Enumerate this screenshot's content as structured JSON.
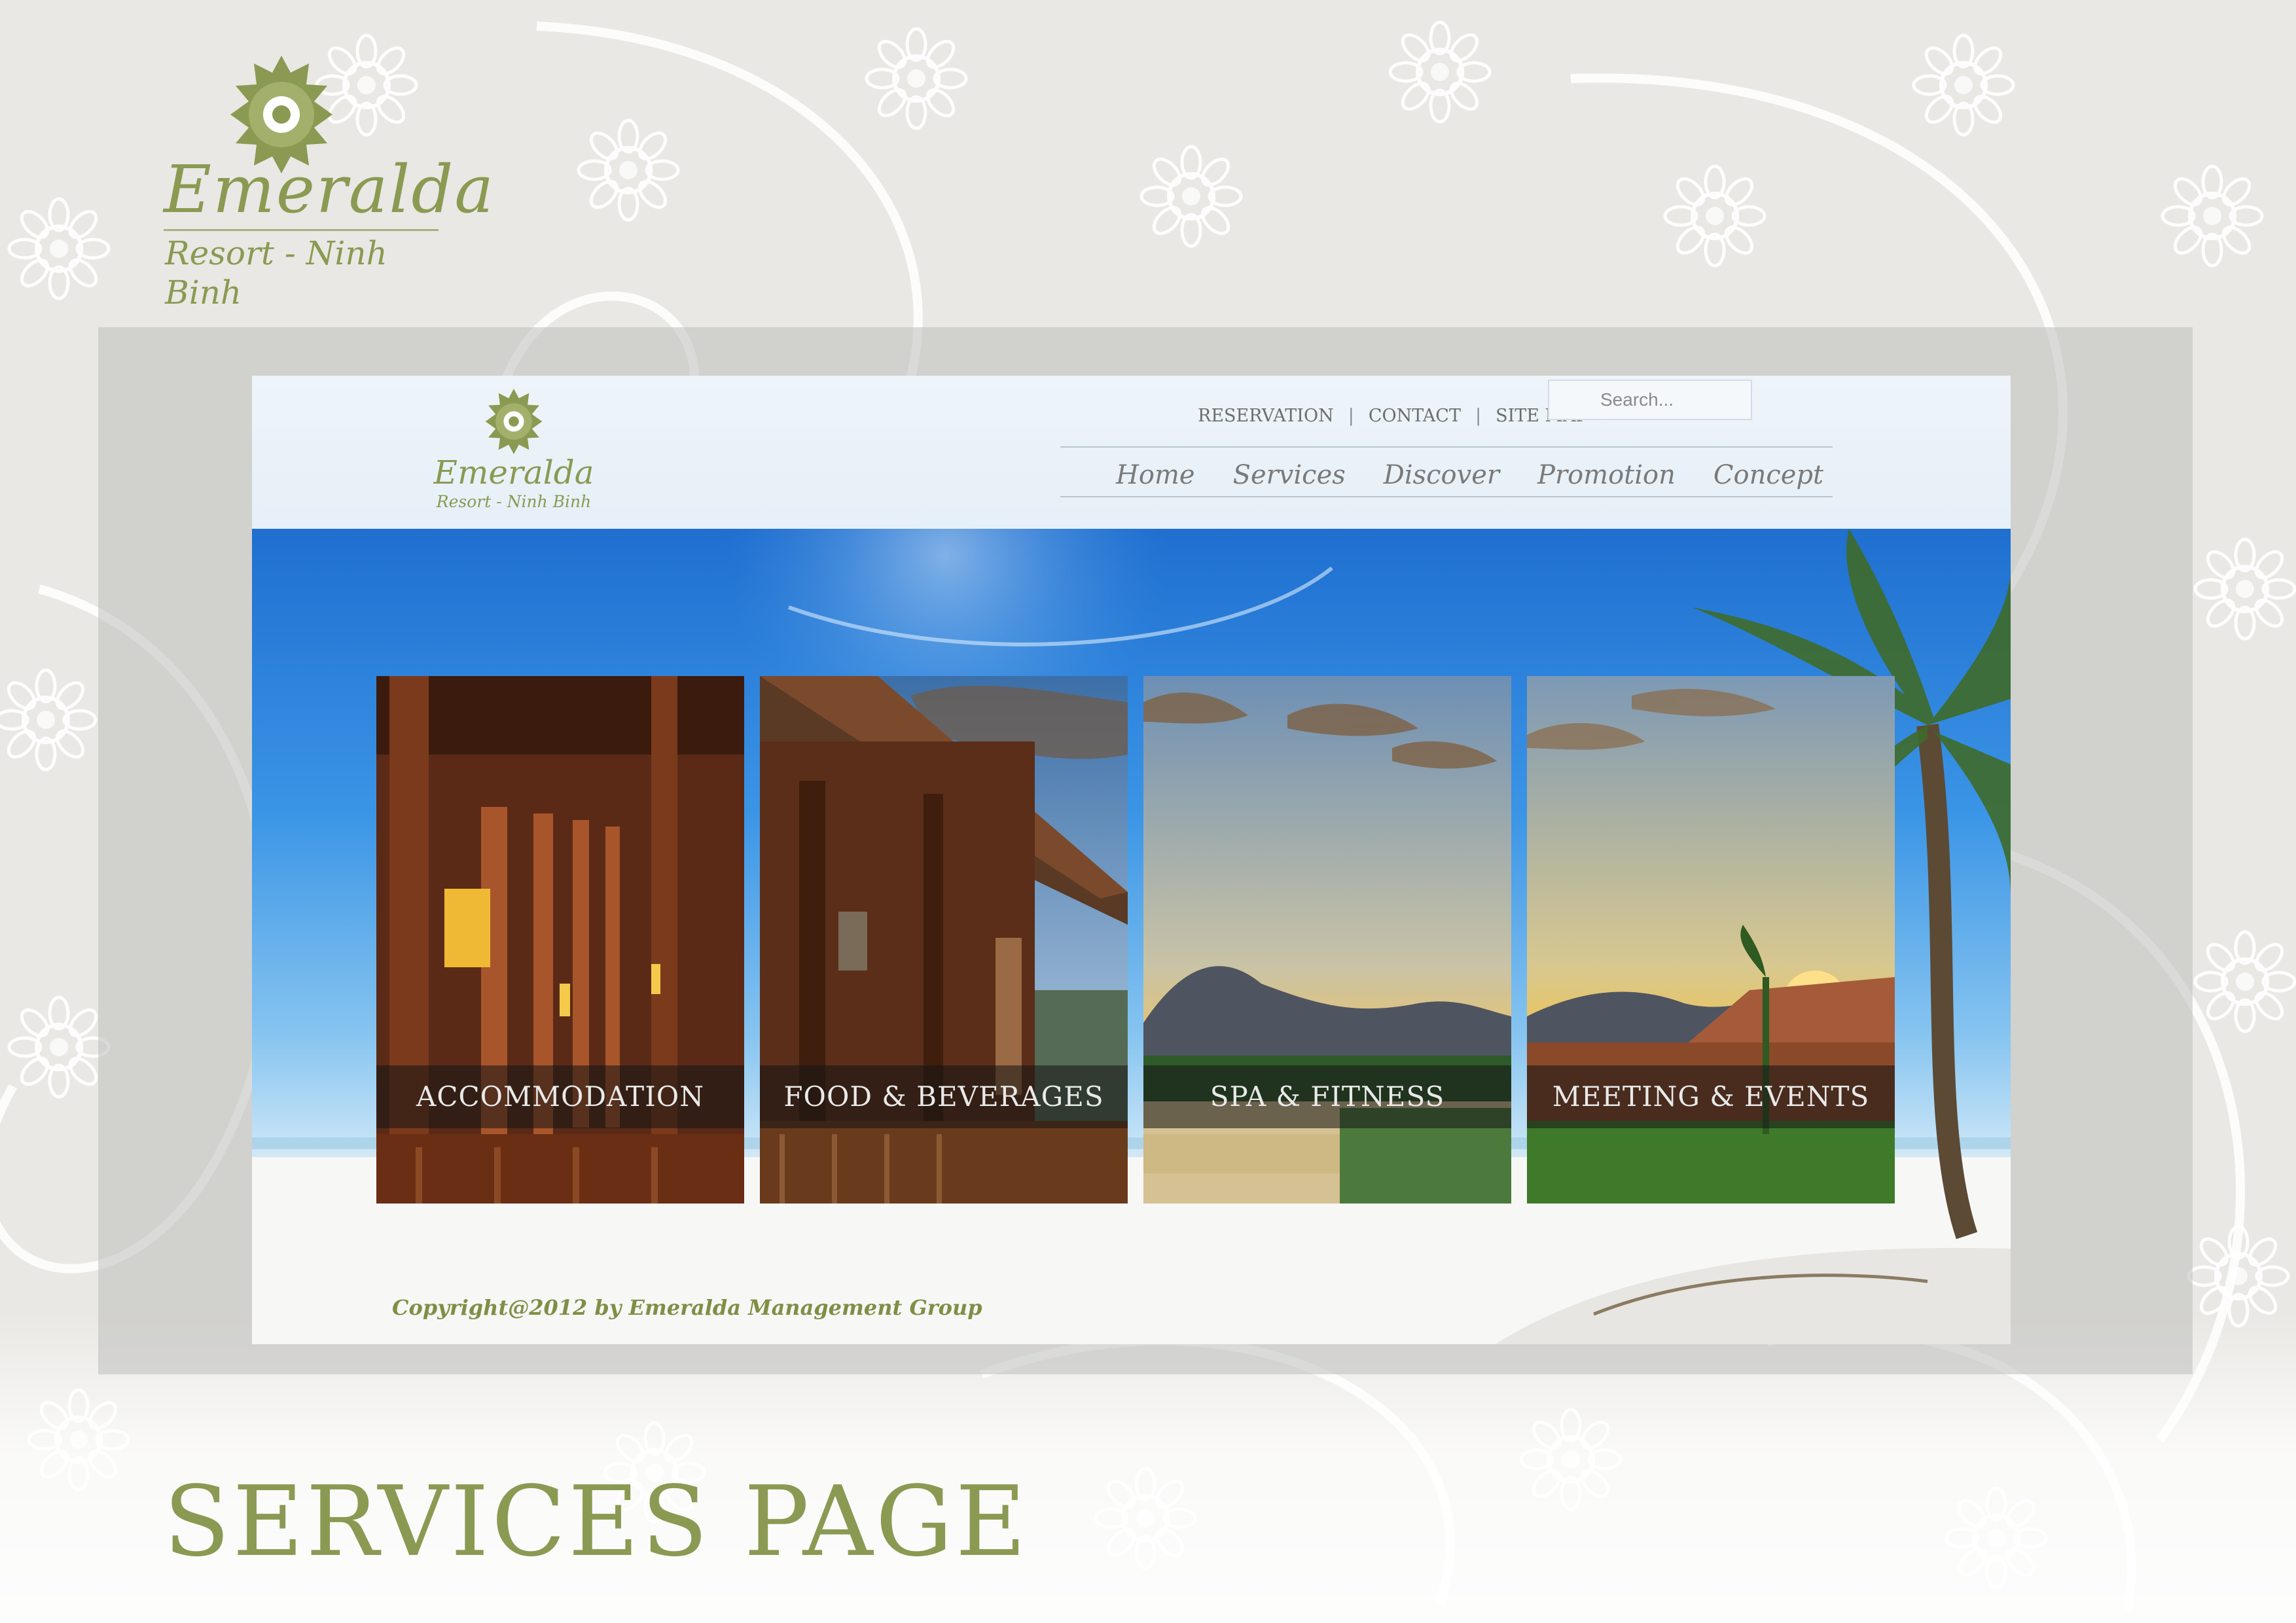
{
  "brand": {
    "name": "Emeralda",
    "tagline": "Resort - Ninh Binh",
    "color": "#8a9a52"
  },
  "site": {
    "logo": {
      "name": "Emeralda",
      "tagline": "Resort - Ninh Binh"
    },
    "utility_nav": [
      "RESERVATION",
      "CONTACT",
      "SITE MAP"
    ],
    "search": {
      "placeholder": "Search..."
    },
    "main_nav": [
      "Home",
      "Services",
      "Discover",
      "Promotion",
      "Concept"
    ],
    "cards": [
      {
        "label": "ACCOMMODATION"
      },
      {
        "label": "FOOD & BEVERAGES"
      },
      {
        "label": "SPA & FITNESS"
      },
      {
        "label": "MEETING & EVENTS"
      }
    ],
    "copyright": "Copyright@2012 by Emeralda Management Group"
  },
  "page_title": "SERVICES PAGE",
  "icons": [
    "lotus-logo-icon"
  ]
}
